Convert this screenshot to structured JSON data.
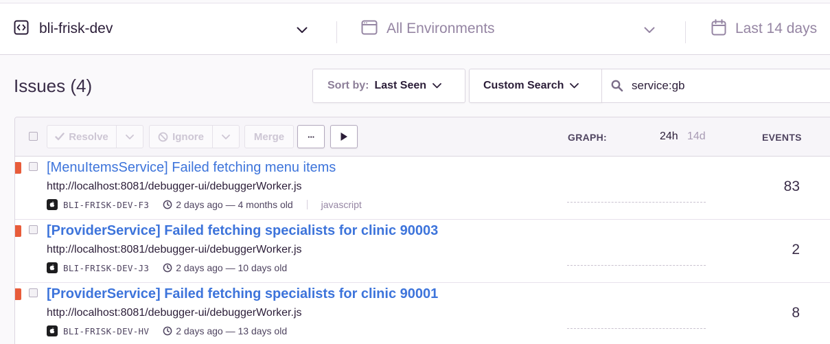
{
  "filters": {
    "project": "bli-frisk-dev",
    "environment": "All Environments",
    "date_range": "Last 14 days"
  },
  "header": {
    "title": "Issues (4)",
    "sort_by_label": "Sort by:",
    "sort_by_value": "Last Seen",
    "custom_search_label": "Custom Search",
    "search_value": "service:gb"
  },
  "toolbar": {
    "resolve_label": "Resolve",
    "ignore_label": "Ignore",
    "merge_label": "Merge",
    "more_label": "···",
    "graph_label": "GRAPH:",
    "range_24h": "24h",
    "range_14d": "14d",
    "events_label": "EVENTS"
  },
  "issues": [
    {
      "title": "[MenuItemsService] Failed fetching menu items",
      "culprit": "http://localhost:8081/debugger-ui/debuggerWorker.js",
      "short_id": "BLI-FRISK-DEV-F3",
      "age": "2 days ago — 4 months old",
      "platform": "javascript",
      "events": "83"
    },
    {
      "title": "[ProviderService] Failed fetching specialists for clinic 90003",
      "culprit": "http://localhost:8081/debugger-ui/debuggerWorker.js",
      "short_id": "BLI-FRISK-DEV-J3",
      "age": "2 days ago — 10 days old",
      "events": "2"
    },
    {
      "title": "[ProviderService] Failed fetching specialists for clinic 90001",
      "culprit": "http://localhost:8081/debugger-ui/debuggerWorker.js",
      "short_id": "BLI-FRISK-DEV-HV",
      "age": "2 days ago — 13 days old",
      "events": "8"
    }
  ],
  "colors": {
    "error_level": "#e85c3a",
    "link": "#3d74db",
    "text": "#2b1d38",
    "muted": "#9585a3"
  }
}
